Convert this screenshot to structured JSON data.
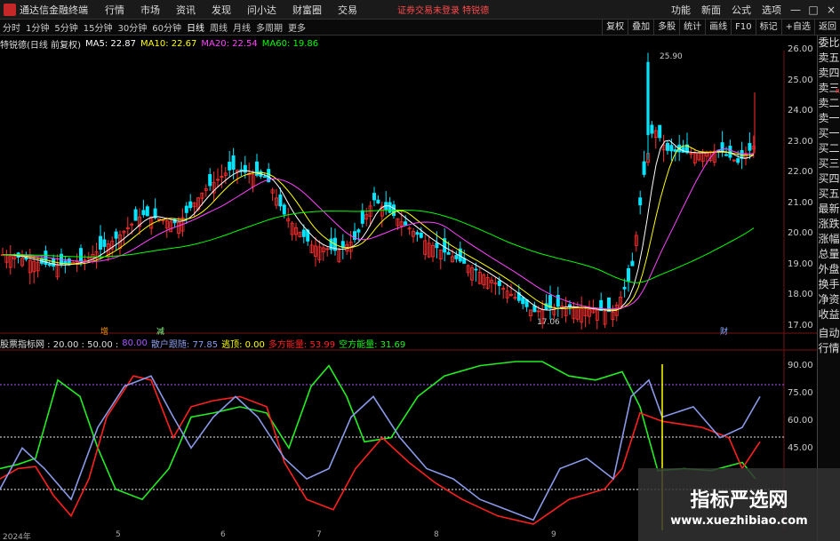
{
  "titlebar": {
    "app_title": "通达信金融终端",
    "menus": [
      "行情",
      "市场",
      "资讯",
      "发现",
      "问小达",
      "财富圈",
      "交易"
    ],
    "promo": "证券交易未登录  特锐德",
    "right_menus": [
      "功能",
      "新面",
      "公式",
      "选项"
    ],
    "min": "—",
    "max": "□",
    "close": "×"
  },
  "toolbar": {
    "periods": [
      "分时",
      "1分钟",
      "5分钟",
      "15分钟",
      "30分钟",
      "60分钟",
      "日线",
      "周线",
      "月线",
      "多周期",
      "更多"
    ],
    "active_period": "日线",
    "tools": [
      "复权",
      "叠加",
      "多股",
      "统计",
      "画线",
      "F10",
      "标记",
      "+自选",
      "返回"
    ]
  },
  "info": {
    "stock": "特锐德(日线 前复权)",
    "ma5": "MA5: 22.87",
    "ma10": "MA10: 22.67",
    "ma20": "MA20: 22.54",
    "ma60": "MA60: 19.86"
  },
  "indicator": {
    "name": "股票指标网 : 20.00 : 50.00 :",
    "v80": "80.00",
    "sanhu": "散户跟随: 77.85",
    "taoding": "逃顶: 0.00",
    "duofang": "多方能量: 53.99",
    "kongfang": "空方能量: 31.69"
  },
  "price_axis": [
    "26.00",
    "25.00",
    "24.00",
    "23.00",
    "22.00",
    "21.00",
    "20.00",
    "19.00",
    "18.00",
    "17.00"
  ],
  "ind_axis": [
    "90.00",
    "75.00",
    "60.00",
    "45.00"
  ],
  "annotations": {
    "high": "25.90",
    "low": "17.06",
    "marker1": "增",
    "marker2": "减",
    "marker3": "财"
  },
  "side_panel": [
    "委比",
    "卖五",
    "卖四",
    "卖三",
    "卖二",
    "卖一",
    "买一",
    "买二",
    "买三",
    "买四",
    "买五",
    "最新",
    "涨跌",
    "涨幅",
    "总量",
    "外盘",
    "换手",
    "净资",
    "收益",
    "自动",
    "行情"
  ],
  "dates": [
    "2024年",
    "5",
    "6",
    "7",
    "8",
    "9"
  ],
  "watermark": {
    "title": "指标严选网",
    "url": "www.xuezhibiao.com"
  },
  "colors": {
    "up": "#ff3030",
    "down": "#00e5ff",
    "ma5": "#ffffff",
    "ma10": "#ffff00",
    "ma20": "#ff44ff",
    "ma60": "#00ff00",
    "red_line": "#ff2020",
    "green_line": "#22ee22",
    "blue_line": "#8a9ae8"
  }
}
